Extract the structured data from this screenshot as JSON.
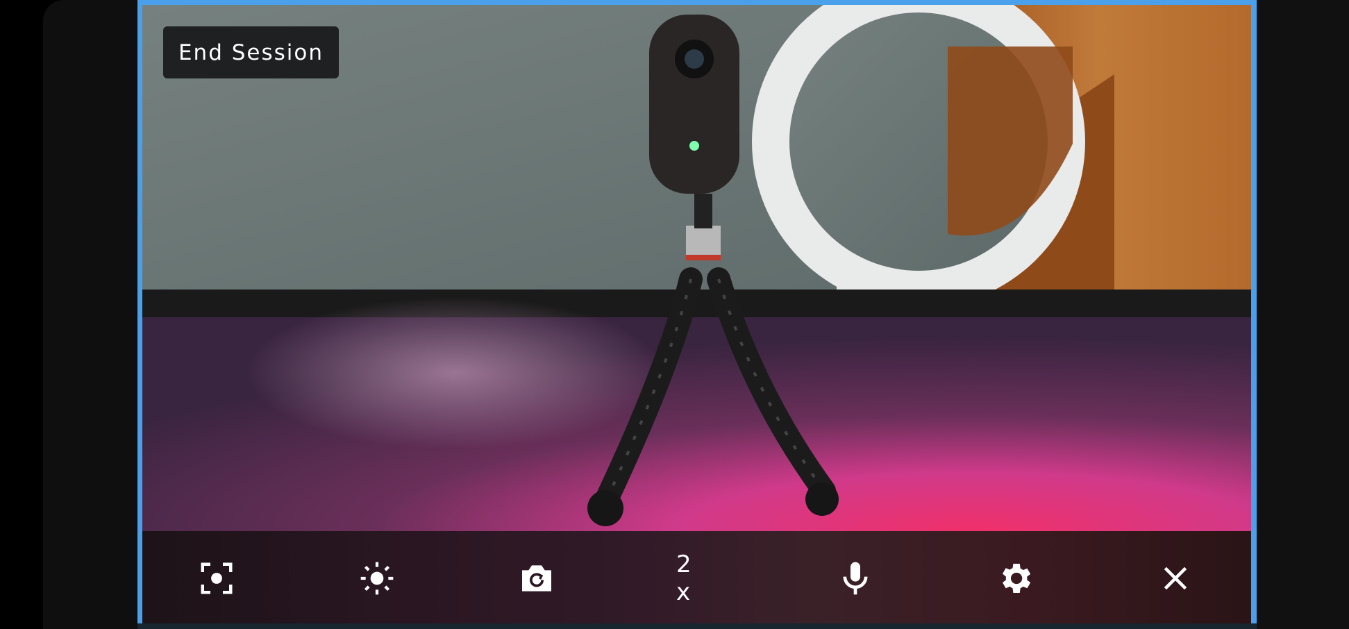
{
  "session": {
    "end_label": "End Session"
  },
  "toolbar": {
    "items": [
      {
        "icon": "focus-icon"
      },
      {
        "icon": "brightness-icon"
      },
      {
        "icon": "switch-camera-icon"
      },
      {
        "label": "2 x"
      },
      {
        "icon": "microphone-icon"
      },
      {
        "icon": "settings-gear-icon"
      },
      {
        "icon": "close-icon"
      }
    ]
  },
  "colors": {
    "accent_border": "#4aa0ea",
    "toolbar_bg": "#2a1622",
    "button_bg": "#1e2022"
  }
}
